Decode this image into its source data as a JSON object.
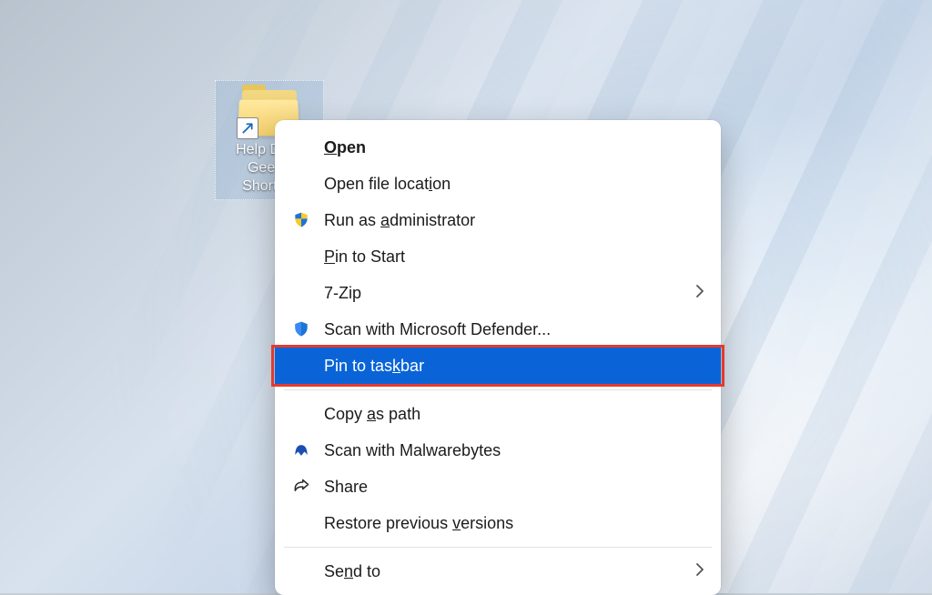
{
  "desktop": {
    "icon_label": "Help Desk\nGeek -\nShortcut"
  },
  "menu": {
    "items": [
      {
        "label_html": "<span class='ul'>O</span>pen",
        "icon": null,
        "bold": true,
        "submenu": false
      },
      {
        "label_html": "Open file locat<span class='ul'>i</span>on",
        "icon": null,
        "bold": false,
        "submenu": false
      },
      {
        "label_html": "Run as <span class='ul'>a</span>dministrator",
        "icon": "shield-uac",
        "bold": false,
        "submenu": false
      },
      {
        "label_html": "<span class='ul'>P</span>in to Start",
        "icon": null,
        "bold": false,
        "submenu": false
      },
      {
        "label_html": "7-Zip",
        "icon": null,
        "bold": false,
        "submenu": true
      },
      {
        "label_html": "Scan with Microsoft Defender...",
        "icon": "shield-defender",
        "bold": false,
        "submenu": false
      },
      {
        "label_html": "Pin to tas<span class='ul'>k</span>bar",
        "icon": null,
        "bold": false,
        "submenu": false,
        "highlighted": true
      },
      {
        "separator": true
      },
      {
        "label_html": "Copy <span class='ul'>a</span>s path",
        "icon": null,
        "bold": false,
        "submenu": false
      },
      {
        "label_html": "Scan with Malwarebytes",
        "icon": "malwarebytes",
        "bold": false,
        "submenu": false
      },
      {
        "label_html": "Share",
        "icon": "share",
        "bold": false,
        "submenu": false
      },
      {
        "label_html": "Restore previous <span class='ul'>v</span>ersions",
        "icon": null,
        "bold": false,
        "submenu": false
      },
      {
        "separator": true
      },
      {
        "label_html": "Se<span class='ul'>n</span>d to",
        "icon": null,
        "bold": false,
        "submenu": true
      }
    ]
  }
}
